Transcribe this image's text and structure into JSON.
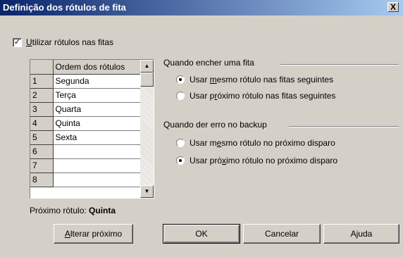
{
  "window": {
    "title": "Definição dos rótulos de fita",
    "close_glyph": "X"
  },
  "use_labels": {
    "checked": true,
    "check_glyph": "✓",
    "label_accel": "U",
    "label_rest": "tilizar rótulos nas fitas"
  },
  "grid": {
    "header": "Ordem dos rótulos",
    "rows": [
      {
        "num": "1",
        "label": "Segunda"
      },
      {
        "num": "2",
        "label": "Terça"
      },
      {
        "num": "3",
        "label": "Quarta"
      },
      {
        "num": "4",
        "label": "Quinta"
      },
      {
        "num": "5",
        "label": "Sexta"
      },
      {
        "num": "6",
        "label": ""
      },
      {
        "num": "7",
        "label": ""
      },
      {
        "num": "8",
        "label": ""
      }
    ],
    "scroll_up_glyph": "▲",
    "scroll_down_glyph": "▼"
  },
  "next": {
    "label": "Próximo rótulo:",
    "value": "Quinta"
  },
  "tape_full": {
    "title": "Quando encher uma fita",
    "options": [
      {
        "pre": "Usar ",
        "accel": "m",
        "post": "esmo rótulo nas fitas seguintes",
        "selected": true
      },
      {
        "pre": "Usar p",
        "accel": "r",
        "post": "óximo rótulo nas fitas seguintes",
        "selected": false
      }
    ]
  },
  "backup_error": {
    "title": "Quando der erro no backup",
    "options": [
      {
        "pre": "Usar m",
        "accel": "e",
        "post": "smo rótulo no próximo disparo",
        "selected": false
      },
      {
        "pre": "Usar pró",
        "accel": "x",
        "post": "imo rótulo no próximo disparo",
        "selected": true
      }
    ]
  },
  "buttons": {
    "change_next_accel": "A",
    "change_next_rest": "lterar próximo",
    "ok": "OK",
    "cancel": "Cancelar",
    "help": "Ajuda"
  }
}
